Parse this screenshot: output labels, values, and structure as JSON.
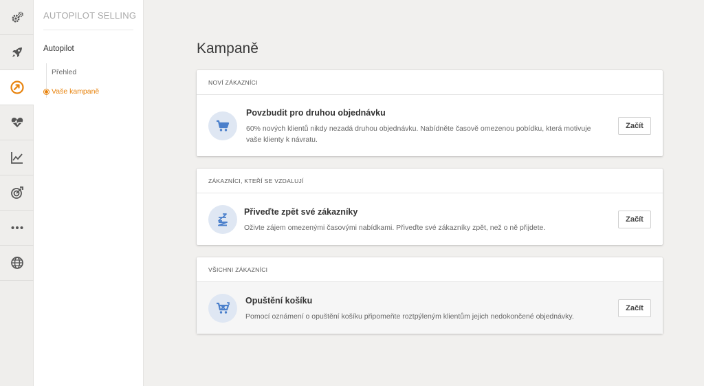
{
  "rail": {
    "items": [
      {
        "icon": "gears-icon"
      },
      {
        "icon": "rocket-icon"
      },
      {
        "icon": "autopilot-icon",
        "active": true
      },
      {
        "icon": "heart-pulse-icon"
      },
      {
        "icon": "chart-line-icon"
      },
      {
        "icon": "target-icon"
      },
      {
        "icon": "more-dots-icon"
      },
      {
        "icon": "globe-icon"
      }
    ],
    "accent_color": "#e8830d"
  },
  "subnav": {
    "title": "AUTOPILOT SELLING",
    "group_label": "Autopilot",
    "links": [
      {
        "label": "Přehled"
      },
      {
        "label": "Vaše kampaně",
        "active": true
      }
    ]
  },
  "main": {
    "title": "Kampaně",
    "cards": [
      {
        "header": "NOVÍ ZÁKAZNÍCI",
        "icon": "cart-icon",
        "title": "Povzbudit pro druhou objednávku",
        "description": "60% nových klientů nikdy nezadá druhou objednávku. Nabídněte časově omezenou pobídku, která motivuje vaše klienty k návratu.",
        "button": "Začít"
      },
      {
        "header": "ZÁKAZNÍCI, KTEŘÍ SE VZDALUJÍ",
        "icon": "sleep-zzz-icon",
        "title": "Přiveďte zpět své zákazníky",
        "description": "Oživte zájem omezenými časovými nabídkami. Přiveďte své zákazníky zpět, než o ně přijdete.",
        "button": "Začít"
      },
      {
        "header": "VŠICHNI ZÁKAZNÍCI",
        "icon": "abandoned-cart-icon",
        "title": "Opuštění košíku",
        "description": "Pomocí oznámení o opuštění košíku připomeňte roztpýleným klientům jejich nedokončené objednávky.",
        "button": "Začít"
      }
    ],
    "icon_color": "#4a7fcb",
    "icon_bg_color": "#dfe7f3"
  }
}
